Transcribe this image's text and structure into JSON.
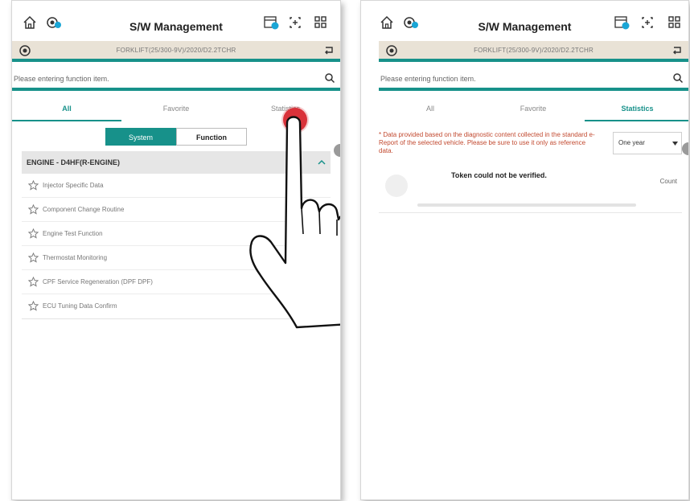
{
  "left_screen": {
    "title": "S/W Management",
    "vehicle": "FORKLIFT(25/300-9V)/2020/D2.2TCHR",
    "search": {
      "placeholder": "Please entering function item."
    },
    "tabs": [
      {
        "label": "All",
        "active": true
      },
      {
        "label": "Favorite",
        "active": false
      },
      {
        "label": "Statistics",
        "active": false
      }
    ],
    "segment": {
      "system_label": "System",
      "function_label": "Function",
      "selected": "System"
    },
    "section": {
      "title": "ENGINE - D4HF(R-ENGINE)"
    },
    "items": [
      {
        "label": "Injector Specific Data"
      },
      {
        "label": "Component Change Routine"
      },
      {
        "label": "Engine Test Function"
      },
      {
        "label": "Thermostat Monitoring"
      },
      {
        "label": "CPF Service Regeneration (DPF DPF)"
      },
      {
        "label": "ECU Tuning Data Confirm"
      }
    ]
  },
  "right_screen": {
    "title": "S/W Management",
    "vehicle": "FORKLIFT(25/300-9V)/2020/D2.2TCHR",
    "search": {
      "placeholder": "Please entering function item."
    },
    "tabs": [
      {
        "label": "All",
        "active": false
      },
      {
        "label": "Favorite",
        "active": false
      },
      {
        "label": "Statistics",
        "active": true
      }
    ],
    "notice": "* Data provided based on the diagnostic content collected in the standard e-Report of the selected vehicle. Please be sure to use it only as reference data.",
    "period": {
      "selected": "One year"
    },
    "message": "Token could not be verified.",
    "count_label": "Count"
  },
  "colors": {
    "accent": "#17918a",
    "vehicle_bar": "#e9e2d6",
    "notice": "#c24a30",
    "touch": "#d9323a"
  }
}
